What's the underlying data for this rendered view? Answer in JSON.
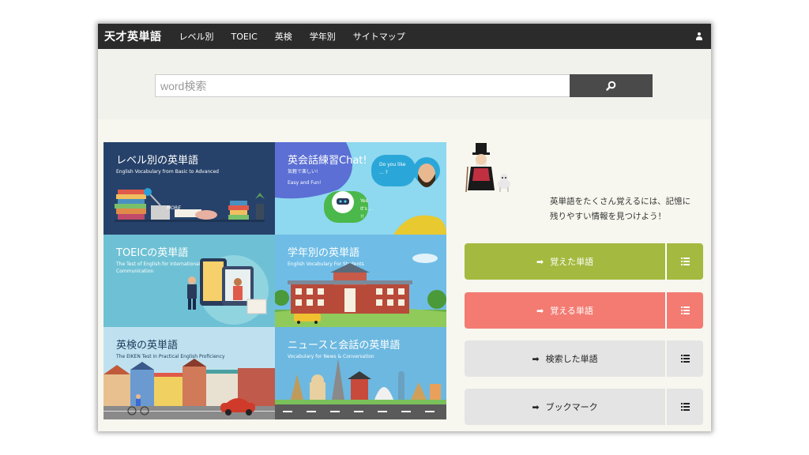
{
  "nav": {
    "brand": "天才英単語",
    "items": [
      "レベル別",
      "TOEIC",
      "英検",
      "学年別",
      "サイトマップ"
    ]
  },
  "search": {
    "placeholder": "word検索"
  },
  "tiles": [
    {
      "title": "レベル別の英単語",
      "subtitle": "English Vocabulary from Basic to Advanced",
      "more": "MORE"
    },
    {
      "title": "英会話練習Chat!",
      "subtitle": "気軽で楽しい!",
      "subtitle2": "Easy and Fun!",
      "bubble1": "Do you like ... ?",
      "bubble2": "Yes It's ... !!"
    },
    {
      "title": "TOEICの英単語",
      "subtitle": "The Test of English for International Communication"
    },
    {
      "title": "学年別の英単語",
      "subtitle": "English Vocabulary For Students"
    },
    {
      "title": "英検の英単語",
      "subtitle": "The EIKEN Test in Practical English Proficiency"
    },
    {
      "title": "ニュースと会話の英単語",
      "subtitle": "Vocabulary for News & Conversation"
    }
  ],
  "tagline": {
    "line1": "英単語をたくさん覚えるには、記憶に",
    "line2": "残りやすい情報を見つけよう！"
  },
  "buttons": [
    {
      "label": "覚えた単語",
      "color": "#a4b93f"
    },
    {
      "label": "覚える単語",
      "color": "#f37b72"
    },
    {
      "label": "検索した単語",
      "color": "#e4e4e4"
    },
    {
      "label": "ブックマーク",
      "color": "#e4e4e4"
    }
  ],
  "icons": {
    "search": "search-icon",
    "user": "user-icon",
    "arrow": "arrow-right-icon",
    "list": "list-icon"
  }
}
